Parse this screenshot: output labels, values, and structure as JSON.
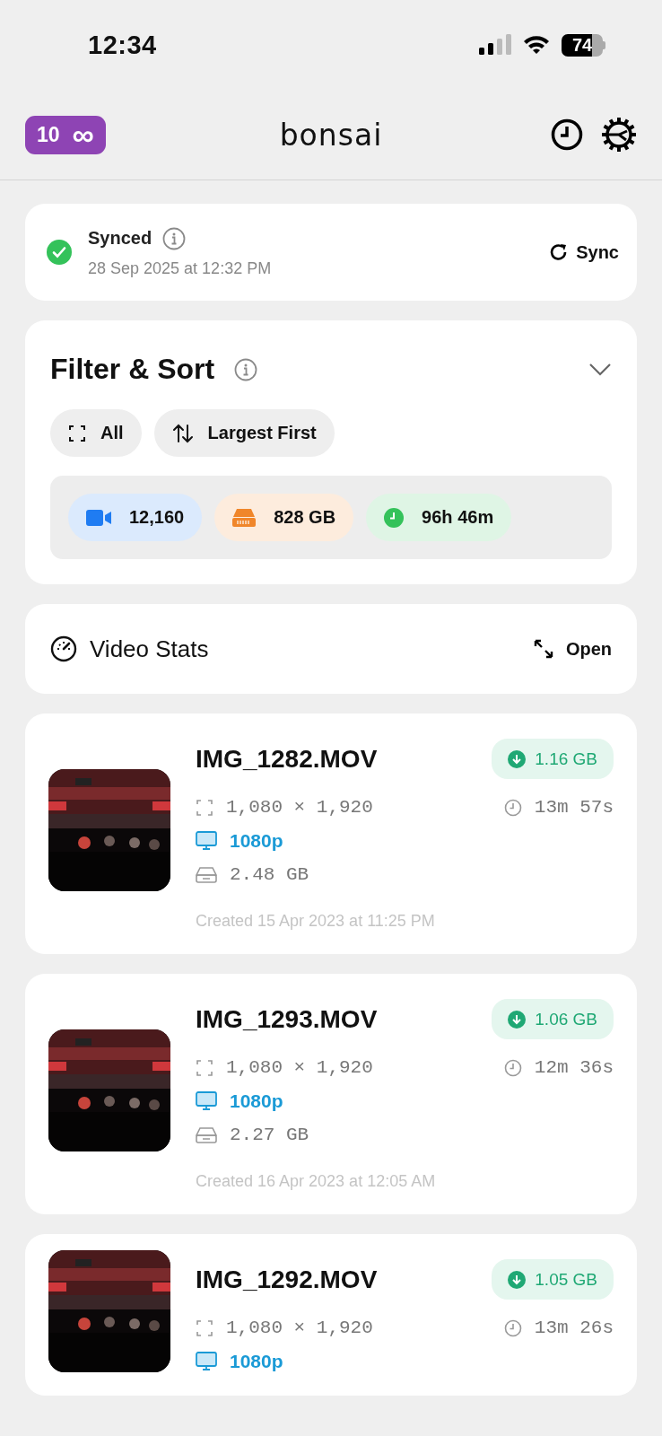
{
  "status_bar": {
    "time": "12:34",
    "battery": "74"
  },
  "header": {
    "badge_count": "10",
    "badge_symbol": "∞",
    "title": "bonsai"
  },
  "sync": {
    "status": "Synced",
    "synced": true,
    "timestamp": "28 Sep 2025 at 12:32 PM",
    "button": "Sync"
  },
  "filter": {
    "title": "Filter & Sort",
    "expanded": false,
    "chips": [
      {
        "kind": "filter",
        "label": "All"
      },
      {
        "kind": "sort",
        "label": "Largest First"
      }
    ],
    "stats": [
      {
        "kind": "video",
        "value": "12,160",
        "color": "#1f7cf2"
      },
      {
        "kind": "storage",
        "value": "828 GB",
        "color": "#f0862a"
      },
      {
        "kind": "clock",
        "value": "96h 46m",
        "color": "#34c25a"
      }
    ]
  },
  "video_stats": {
    "title": "Video Stats",
    "button": "Open"
  },
  "videos": [
    {
      "name": "IMG_1282.MOV",
      "saving": "1.16 GB",
      "dimensions": "1,080 × 1,920",
      "duration": "13m 57s",
      "resolution": "1080p",
      "size": "2.48 GB",
      "created": "Created 15 Apr 2023 at 11:25 PM"
    },
    {
      "name": "IMG_1293.MOV",
      "saving": "1.06 GB",
      "dimensions": "1,080 × 1,920",
      "duration": "12m 36s",
      "resolution": "1080p",
      "size": "2.27 GB",
      "created": "Created 16 Apr 2023 at 12:05 AM"
    },
    {
      "name": "IMG_1292.MOV",
      "saving": "1.05 GB",
      "dimensions": "1,080 × 1,920",
      "duration": "13m 26s",
      "resolution": "1080p"
    }
  ]
}
